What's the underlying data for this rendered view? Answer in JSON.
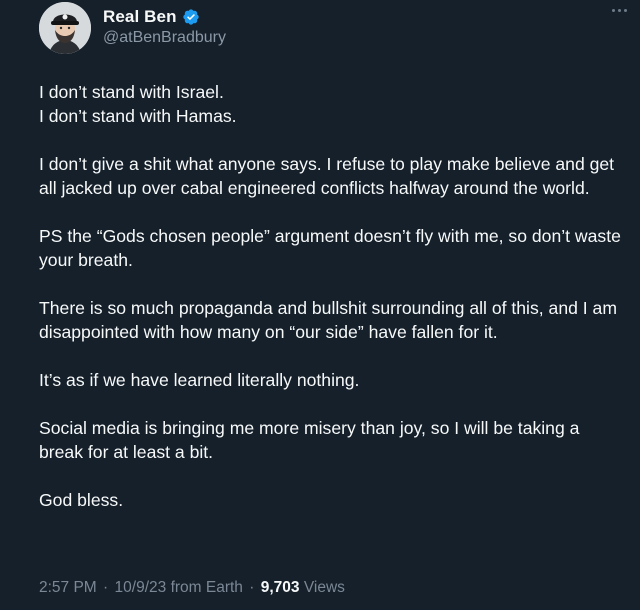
{
  "author": {
    "display_name": "Real Ben",
    "handle": "@atBenBradbury",
    "verified_color": "#1d9bf0",
    "avatar_icon": "profile-photo-man-cap"
  },
  "tweet": {
    "paragraphs": [
      "I don’t stand with Israel.\nI don’t stand with Hamas.",
      "I don’t give a shit what anyone says. I refuse to play make believe and get all jacked up over cabal engineered conflicts halfway around the world.",
      "PS the “Gods chosen people” argument doesn’t fly with me, so don’t waste your breath.",
      "There is so much propaganda and bullshit surrounding all of this, and I am disappointed with how many on “our side” have fallen for it.",
      "It’s as if we have learned literally nothing.",
      "Social media is bringing me more misery than joy, so I will be taking a break for at least a bit.",
      "God bless."
    ]
  },
  "meta": {
    "time": "2:57 PM",
    "date": "10/9/23",
    "source": "from Earth",
    "views_count": "9,703",
    "views_label": "Views",
    "separator": "·"
  },
  "colors": {
    "background": "#15202b",
    "text": "#f7f9f9",
    "secondary": "#8b98a5"
  }
}
